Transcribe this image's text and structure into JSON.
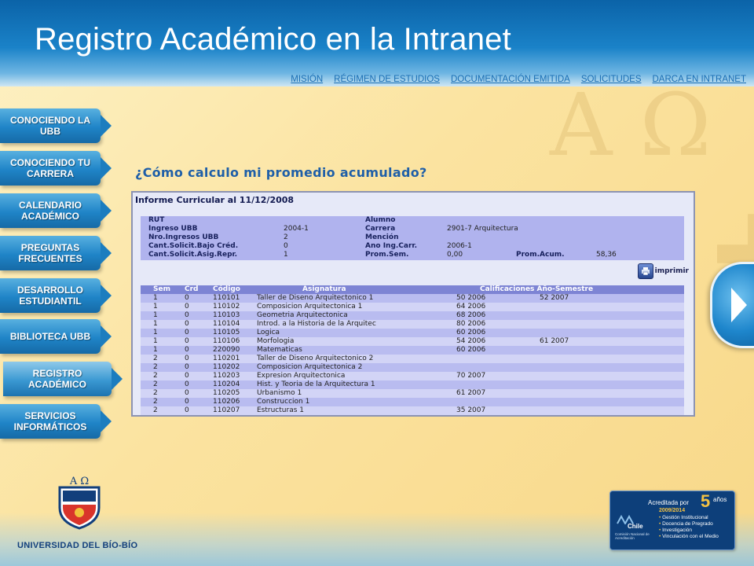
{
  "header": {
    "title": "Registro Académico en la Intranet",
    "nav": [
      "MISIÓN",
      "RÉGIMEN DE ESTUDIOS",
      "DOCUMENTACIÓN EMITIDA",
      "SOLICITUDES",
      "DARCA EN INTRANET"
    ]
  },
  "sidebar": {
    "items": [
      {
        "label": "CONOCIENDO LA UBB"
      },
      {
        "label": "CONOCIENDO TU CARRERA"
      },
      {
        "label": "CALENDARIO ACADÉMICO"
      },
      {
        "label": "PREGUNTAS FRECUENTES"
      },
      {
        "label": "DESARROLLO ESTUDIANTIL"
      },
      {
        "label": "BIBLIOTECA UBB"
      },
      {
        "label": "REGISTRO ACADÉMICO"
      },
      {
        "label": "SERVICIOS INFORMÁTICOS"
      }
    ]
  },
  "main": {
    "question": "¿Cómo calculo mi promedio acumulado?"
  },
  "report": {
    "title": "Informe Curricular al 11/12/2008",
    "info": {
      "rut_label": "RUT",
      "alumno_label": "Alumno",
      "ingreso_label": "Ingreso UBB",
      "ingreso_value": "2004-1",
      "carrera_label": "Carrera",
      "carrera_value": "2901-7 Arquitectura",
      "nro_label": "Nro.Ingresos UBB",
      "nro_value": "2",
      "mencion_label": "Mención",
      "bajo_label": "Cant.Solicit.Bajo Créd.",
      "bajo_value": "0",
      "ano_label": "Ano Ing.Carr.",
      "ano_value": "2006-1",
      "repr_label": "Cant.Solicit.Asig.Repr.",
      "repr_value": "1",
      "promsem_label": "Prom.Sem.",
      "promsem_value": "0,00",
      "promacum_label": "Prom.Acum.",
      "promacum_value": "58,36"
    },
    "print_label": "imprimir",
    "columns": {
      "sem": "Sem",
      "crd": "Crd",
      "codigo": "Código",
      "asignatura": "Asignatura",
      "calif": "Calificaciones Año-Semestre"
    },
    "rows": [
      {
        "sem": "1",
        "crd": "0",
        "code": "110101",
        "name": "Taller de Diseno Arquitectonico 1",
        "c1": "50 2006",
        "c2": "52 2007"
      },
      {
        "sem": "1",
        "crd": "0",
        "code": "110102",
        "name": "Composicion Arquitectonica 1",
        "c1": "64 2006",
        "c2": ""
      },
      {
        "sem": "1",
        "crd": "0",
        "code": "110103",
        "name": "Geometria Arquitectonica",
        "c1": "68 2006",
        "c2": ""
      },
      {
        "sem": "1",
        "crd": "0",
        "code": "110104",
        "name": "Introd. a la Historia de la Arquitec",
        "c1": "80 2006",
        "c2": ""
      },
      {
        "sem": "1",
        "crd": "0",
        "code": "110105",
        "name": "Logica",
        "c1": "60 2006",
        "c2": ""
      },
      {
        "sem": "1",
        "crd": "0",
        "code": "110106",
        "name": "Morfologia",
        "c1": "54 2006",
        "c2": "61 2007"
      },
      {
        "sem": "1",
        "crd": "0",
        "code": "220090",
        "name": "Matematicas",
        "c1": "60 2006",
        "c2": ""
      },
      {
        "sem": "2",
        "crd": "0",
        "code": "110201",
        "name": "Taller de Diseno Arquitectonico 2",
        "c1": "",
        "c2": ""
      },
      {
        "sem": "2",
        "crd": "0",
        "code": "110202",
        "name": "Composicion Arquitectonica 2",
        "c1": "",
        "c2": ""
      },
      {
        "sem": "2",
        "crd": "0",
        "code": "110203",
        "name": "Expresion Arquitectonica",
        "c1": "70 2007",
        "c2": ""
      },
      {
        "sem": "2",
        "crd": "0",
        "code": "110204",
        "name": "Hist. y Teoria de la Arquitectura 1",
        "c1": "",
        "c2": ""
      },
      {
        "sem": "2",
        "crd": "0",
        "code": "110205",
        "name": "Urbanismo 1",
        "c1": "61 2007",
        "c2": ""
      },
      {
        "sem": "2",
        "crd": "0",
        "code": "110206",
        "name": "Construccion 1",
        "c1": "",
        "c2": ""
      },
      {
        "sem": "2",
        "crd": "0",
        "code": "110207",
        "name": "Estructuras 1",
        "c1": "35 2007",
        "c2": ""
      }
    ]
  },
  "footer": {
    "university": "UNIVERSIDAD DEL BÍO-BÍO",
    "accreditation": {
      "title": "Acreditada por",
      "number": "5",
      "unit": "años",
      "years": "2009/2014",
      "chile": "Chile",
      "commission": "Comisión Nacional de Acreditación",
      "areas": [
        "Gestión Institucional",
        "Docencia de Pregrado",
        "Investigación",
        "Vinculación con el Medio"
      ]
    }
  },
  "colors": {
    "header_blue": "#1a82c8",
    "nav_link": "#1b6fb5",
    "question_text": "#1f5fa8",
    "table_header": "#7d84d4",
    "row_light": "#d2d4f6",
    "row_dark": "#b9bcf0"
  },
  "icons": {
    "print": "printer-icon",
    "next": "play-arrow-icon",
    "logo": "university-shield-logo"
  }
}
